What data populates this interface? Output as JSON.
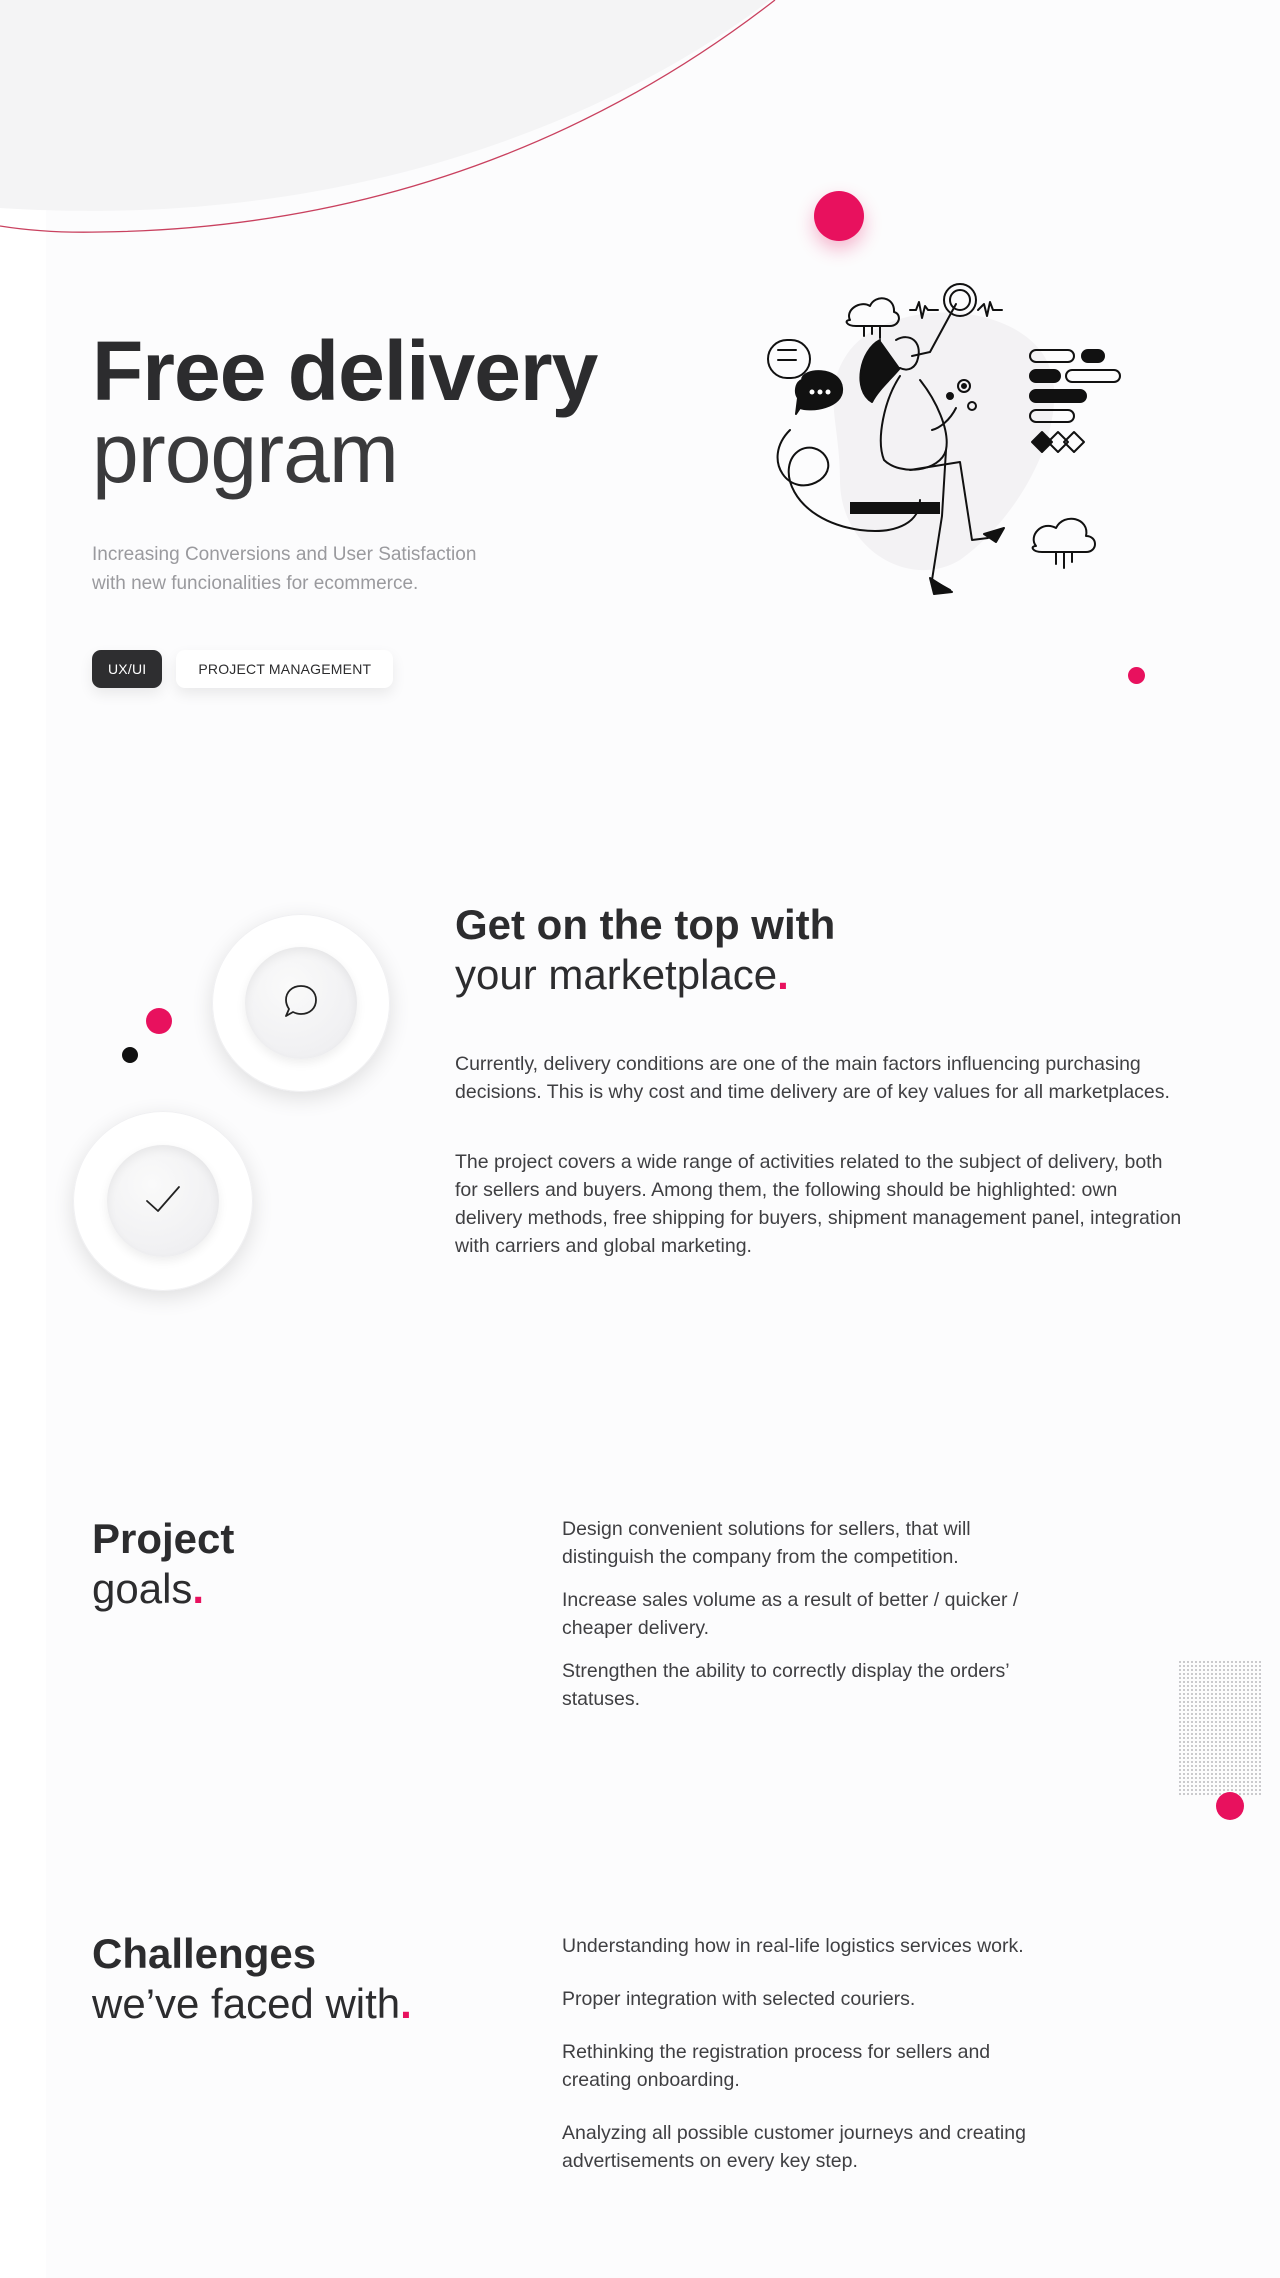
{
  "hero": {
    "title_bold": "Free delivery",
    "title_light": "program",
    "subtitle_line1": "Increasing Conversions and User Satisfaction",
    "subtitle_line2": "with new funcionalities for ecommerce.",
    "tags": [
      "UX/UI",
      "PROJECT MANAGEMENT"
    ]
  },
  "section_marketplace": {
    "title_bold": "Get on the top with",
    "title_light": "your marketplace",
    "title_dot": ".",
    "paragraph_1": "Currently, delivery conditions are one of the main factors influencing purchasing decisions. This is why cost and time delivery are of key values for all marketplaces.",
    "paragraph_2": "The project covers a wide range of activities related to the subject of delivery, both for sellers and buyers. Among them, the following should be highlighted: own delivery methods, free shipping for buyers, shipment management panel, integration with carriers and global marketing."
  },
  "section_goals": {
    "title_bold": "Project",
    "title_light": "goals",
    "title_dot": ".",
    "items": [
      "Design convenient solutions for sellers, that will distinguish the company from the competition.",
      "Increase sales volume as a result of better / quicker / cheaper delivery.",
      "Strengthen the ability to correctly display the orders’ statuses."
    ]
  },
  "section_challenges": {
    "title_bold": "Challenges",
    "title_light": "we’ve faced with",
    "title_dot": ".",
    "items": [
      "Understanding how in real-life logistics services work.",
      "Proper integration with selected couriers.",
      "Rethinking the registration process for sellers and creating onboarding.",
      "Analyzing all possible customer journeys and creating advertisements on every key step."
    ]
  },
  "colors": {
    "accent": "#e8115e",
    "text_dark": "#2c2c2e",
    "text_muted": "#9a9a9e"
  },
  "icons": [
    "chat-bubble-icon",
    "checkmark-icon"
  ]
}
